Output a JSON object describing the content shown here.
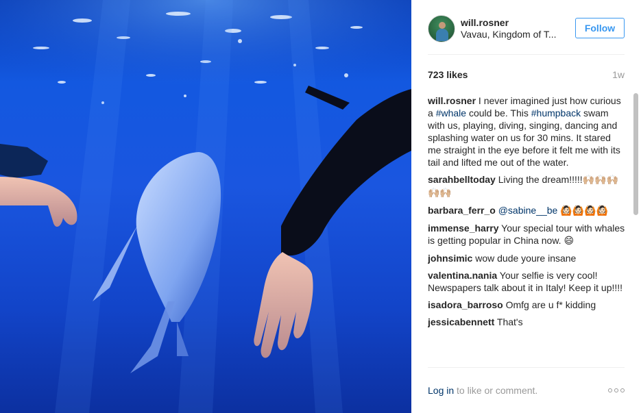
{
  "post": {
    "username": "will.rosner",
    "location": "Vavau, Kingdom of T...",
    "follow_label": "Follow",
    "likes": "723 likes",
    "age": "1w"
  },
  "comments": [
    {
      "user": "will.rosner",
      "parts": [
        {
          "t": "I never imagined just how curious a "
        },
        {
          "t": "#whale",
          "k": "hashtag"
        },
        {
          "t": " could be. This "
        },
        {
          "t": "#humpback",
          "k": "hashtag"
        },
        {
          "t": " swam with us, playing, diving, singing, dancing and splashing water on us for 30 mins. It stared me straight in the eye before it felt me with its tail and lifted me out of the water."
        }
      ]
    },
    {
      "user": "sarahbelltoday",
      "parts": [
        {
          "t": "Living the dream!!!!!"
        },
        {
          "t": "🙌🏼🙌🏼🙌🏼🙌🏼🙌🏼",
          "k": "emo"
        }
      ]
    },
    {
      "user": "barbara_ferr_o",
      "parts": [
        {
          "t": "@sabine__be",
          "k": "mention"
        },
        {
          "t": " "
        },
        {
          "t": "🙆🏻🙆🏻🙆🏻🙆🏻",
          "k": "emo"
        }
      ]
    },
    {
      "user": "immense_harry",
      "parts": [
        {
          "t": "Your special tour with whales is getting popular in China now. "
        },
        {
          "t": "😄",
          "k": "emo"
        }
      ]
    },
    {
      "user": "johnsimic",
      "parts": [
        {
          "t": "wow dude youre insane"
        }
      ]
    },
    {
      "user": "valentina.nania",
      "parts": [
        {
          "t": "Your selfie is very cool! Newspapers talk about it in Italy! Keep it up!!!!"
        }
      ]
    },
    {
      "user": "isadora_barroso",
      "parts": [
        {
          "t": "Omfg are u f* kidding"
        }
      ]
    },
    {
      "user": "jessicabennett",
      "parts": [
        {
          "t": "That's"
        }
      ]
    }
  ],
  "footer": {
    "login_link": "Log in",
    "login_rest": " to like or comment."
  },
  "icons": {
    "more": "more-options-icon"
  }
}
